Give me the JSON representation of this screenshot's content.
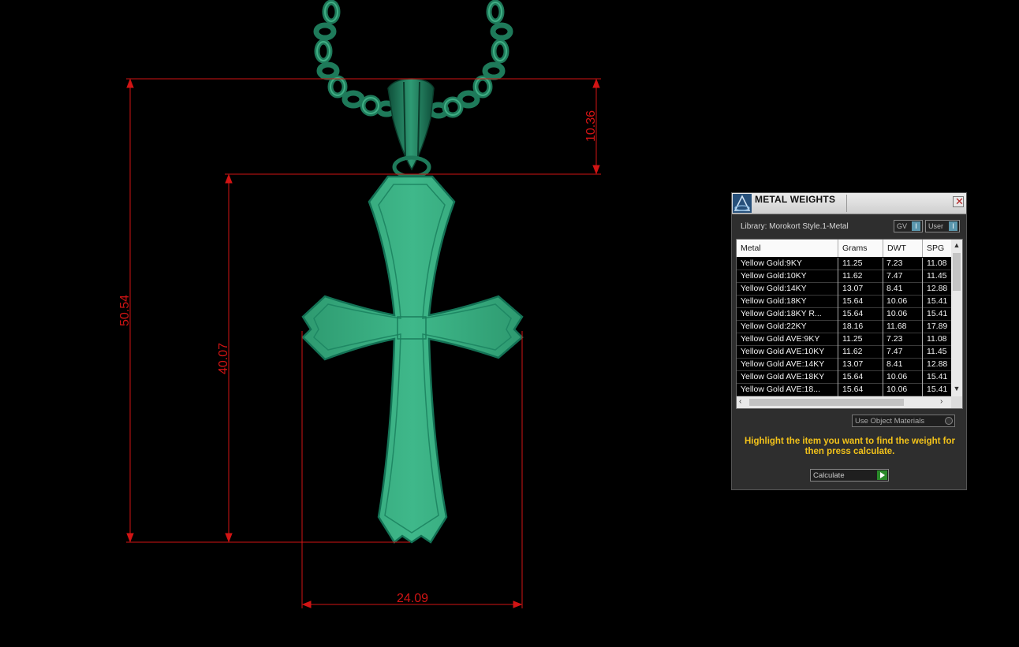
{
  "dimensions": {
    "total_height": "50.54",
    "cross_height": "40.07",
    "bail_height": "10.36",
    "width": "24.09"
  },
  "panel": {
    "title": "METAL WEIGHTS",
    "close_symbol": "✕",
    "library_label": "Library: Morokort Style.1-Metal",
    "gv_label": "GV",
    "user_label": "User",
    "toggle_mark": "I",
    "columns": {
      "metal": "Metal",
      "grams": "Grams",
      "dwt": "DWT",
      "spg": "SPG"
    },
    "rows": [
      {
        "metal": "Yellow Gold:9KY",
        "grams": "11.25",
        "dwt": "7.23",
        "spg": "11.08"
      },
      {
        "metal": "Yellow Gold:10KY",
        "grams": "11.62",
        "dwt": "7.47",
        "spg": "11.45"
      },
      {
        "metal": "Yellow Gold:14KY",
        "grams": "13.07",
        "dwt": "8.41",
        "spg": "12.88"
      },
      {
        "metal": "Yellow Gold:18KY",
        "grams": "15.64",
        "dwt": "10.06",
        "spg": "15.41"
      },
      {
        "metal": "Yellow Gold:18KY R...",
        "grams": "15.64",
        "dwt": "10.06",
        "spg": "15.41"
      },
      {
        "metal": "Yellow Gold:22KY",
        "grams": "18.16",
        "dwt": "11.68",
        "spg": "17.89"
      },
      {
        "metal": "Yellow Gold AVE:9KY",
        "grams": "11.25",
        "dwt": "7.23",
        "spg": "11.08"
      },
      {
        "metal": "Yellow Gold AVE:10KY",
        "grams": "11.62",
        "dwt": "7.47",
        "spg": "11.45"
      },
      {
        "metal": "Yellow Gold AVE:14KY",
        "grams": "13.07",
        "dwt": "8.41",
        "spg": "12.88"
      },
      {
        "metal": "Yellow Gold AVE:18KY",
        "grams": "15.64",
        "dwt": "10.06",
        "spg": "15.41"
      },
      {
        "metal": "Yellow Gold AVE:18...",
        "grams": "15.64",
        "dwt": "10.06",
        "spg": "15.41"
      }
    ],
    "use_object_materials": "Use Object Materials",
    "instructions": "Highlight the item you want to find the weight for then press calculate.",
    "calculate_label": "Calculate"
  },
  "colors": {
    "dimension_red": "#d21414",
    "cross_green": "#35a97e",
    "instruction_yellow": "#f2c21a"
  }
}
